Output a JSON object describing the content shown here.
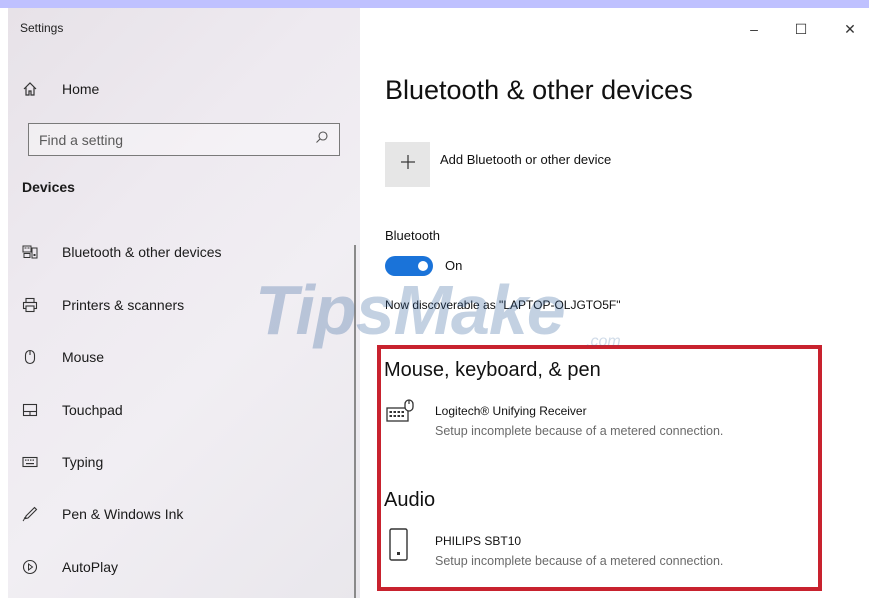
{
  "window": {
    "title": "Settings",
    "minimize_glyph": "–",
    "maximize_glyph": "☐",
    "close_glyph": "✕"
  },
  "sidebar": {
    "home_label": "Home",
    "search_placeholder": "Find a setting",
    "section_header": "Devices",
    "items": [
      {
        "label": "Bluetooth & other devices",
        "icon": "bluetooth-devices-icon"
      },
      {
        "label": "Printers & scanners",
        "icon": "printer-icon"
      },
      {
        "label": "Mouse",
        "icon": "mouse-icon"
      },
      {
        "label": "Touchpad",
        "icon": "touchpad-icon"
      },
      {
        "label": "Typing",
        "icon": "keyboard-icon"
      },
      {
        "label": "Pen & Windows Ink",
        "icon": "pen-icon"
      },
      {
        "label": "AutoPlay",
        "icon": "autoplay-icon"
      }
    ]
  },
  "main": {
    "title": "Bluetooth & other devices",
    "add_device_label": "Add Bluetooth or other device",
    "bluetooth_label": "Bluetooth",
    "bluetooth_state": "On",
    "bluetooth_on": true,
    "discoverable_text": "Now discoverable as \"LAPTOP-OLJGTO5F\"",
    "groups": [
      {
        "title": "Mouse, keyboard, & pen",
        "devices": [
          {
            "name": "Logitech® Unifying Receiver",
            "status": "Setup incomplete because of a metered connection.",
            "icon": "keyboard-mouse-icon"
          }
        ]
      },
      {
        "title": "Audio",
        "devices": [
          {
            "name": "PHILIPS SBT10",
            "status": "Setup incomplete because of a metered connection.",
            "icon": "speaker-icon"
          }
        ]
      }
    ]
  },
  "watermark": {
    "text": "TipsMake",
    "suffix": ".com"
  },
  "colors": {
    "accent": "#1a73d9",
    "highlight": "#c8222e",
    "sidebar_bg": "#ece8ee"
  }
}
